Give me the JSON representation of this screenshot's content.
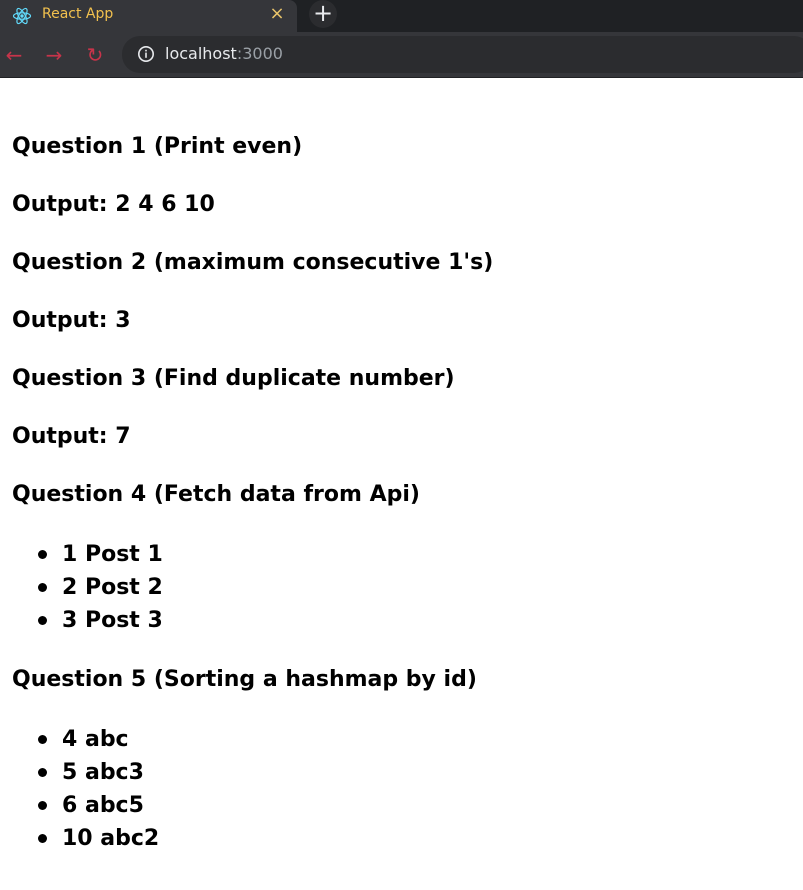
{
  "browser": {
    "tab_title": "React App",
    "tab_close": "×",
    "new_tab": "+",
    "back": "←",
    "forward": "→",
    "reload": "↻",
    "url_host": "localhost",
    "url_port": ":3000"
  },
  "questions": [
    {
      "title": "Question 1 (Print even)",
      "output": "Output: 2 4 6 10"
    },
    {
      "title": "Question 2 (maximum consecutive 1's)",
      "output": "Output: 3"
    },
    {
      "title": "Question 3 (Find duplicate number)",
      "output": "Output: 7"
    },
    {
      "title": "Question 4 (Fetch data from Api)",
      "items": [
        "1 Post 1",
        "2 Post 2",
        "3 Post 3"
      ]
    },
    {
      "title": "Question 5 (Sorting a hashmap by id)",
      "items": [
        "4 abc",
        "5 abc3",
        "6 abc5",
        "10 abc2"
      ]
    }
  ],
  "colors": {
    "tab_title": "#f2c14e",
    "nav_button": "#c7344a",
    "chrome_dark": "#1f2124",
    "chrome": "#35363a"
  }
}
